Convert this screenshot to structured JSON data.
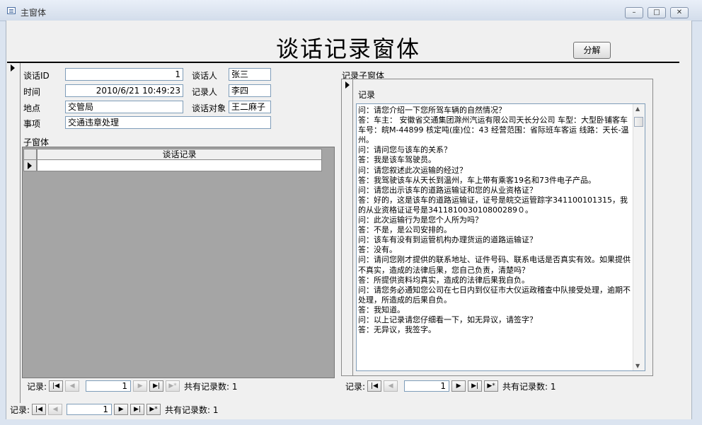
{
  "window": {
    "title": "主窗体",
    "btn_minimize": "–",
    "btn_restore": "□",
    "btn_close": "✕"
  },
  "heading": "谈话记录窗体",
  "split_button": "分解",
  "fields": {
    "talk_id": {
      "label": "谈话ID",
      "value": "1"
    },
    "time": {
      "label": "时间",
      "value": "2010/6/21 10:49:23"
    },
    "location": {
      "label": "地点",
      "value": "交管局"
    },
    "matter": {
      "label": "事项",
      "value": "交通违章处理"
    },
    "talker": {
      "label": "谈话人",
      "value": "张三"
    },
    "recorder": {
      "label": "记录人",
      "value": "李四"
    },
    "subject": {
      "label": "谈话对象",
      "value": "王二麻子"
    }
  },
  "subform": {
    "label": "子窗体",
    "column_header": "谈话记录"
  },
  "record_subform": {
    "label": "记录子窗体",
    "field_label": "记录",
    "text": "问：请您介绍一下您所驾车辆的自然情况？\n答：车主： 安徽省交通集团滁州汽运有限公司天长分公司 车型：大型卧铺客车 车号：皖M-44899 核定吨(座)位：43 经营范围：省际班车客运 线路：天长-温州。\n问：请问您与该车的关系？\n答：我是该车驾驶员。\n问：请您叙述此次运输的经过？\n答：我驾驶该车从天长到温州，车上带有乘客19名和73件电子产品。\n问：请您出示该车的道路运输证和您的从业资格证？\n答：好的，这是该车的道路运输证，证号是皖交运管踪字341100101315，我的从业资格证证号是341181003010800289０。\n问：此次运输行为是您个人所为吗？\n答：不是，是公司安排的。\n问：该车有没有到运管机构办理货运的道路运输证？\n答：没有。\n问：请问您刚才提供的联系地址、证件号码、联系电话是否真实有效。如果提供不真实，造成的法律后果，您自己负责，清楚吗？\n答：所提供资料均真实，造成的法律后果我自负。\n问：请您务必通知您公司在七日内到仪征市大仪运政稽查中队接受处理，逾期不处理，所造成的后果自负。\n答：我知道。\n问：以上记录请您仔细看一下，如无异议，请签字？\n答：无异议，我签字。"
  },
  "navigators": {
    "subform": {
      "label": "记录:",
      "current": "1",
      "total_text": "共有记录数: 1"
    },
    "record": {
      "label": "记录:",
      "current": "1",
      "total_text": "共有记录数: 1"
    },
    "main": {
      "label": "记录:",
      "current": "1",
      "total_text": "共有记录数: 1"
    }
  }
}
